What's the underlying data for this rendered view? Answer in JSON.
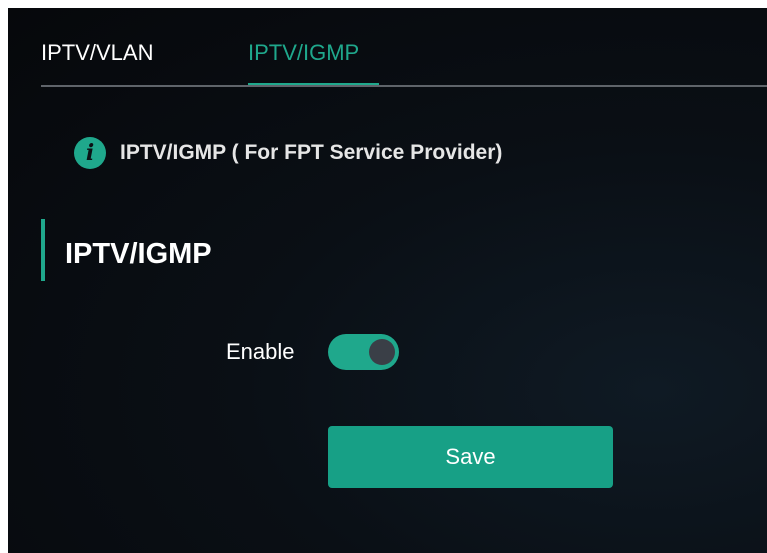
{
  "tabs": [
    {
      "label": "IPTV/VLAN",
      "active": false
    },
    {
      "label": "IPTV/IGMP",
      "active": true
    }
  ],
  "notice": {
    "icon": "info-icon",
    "text": "IPTV/IGMP ( For FPT Service Provider)"
  },
  "section": {
    "title": "IPTV/IGMP"
  },
  "form": {
    "enable_label": "Enable",
    "enable_value": true,
    "save_label": "Save"
  },
  "colors": {
    "accent": "#1fa88c",
    "background": "#0a0f15",
    "text": "#ffffff"
  }
}
